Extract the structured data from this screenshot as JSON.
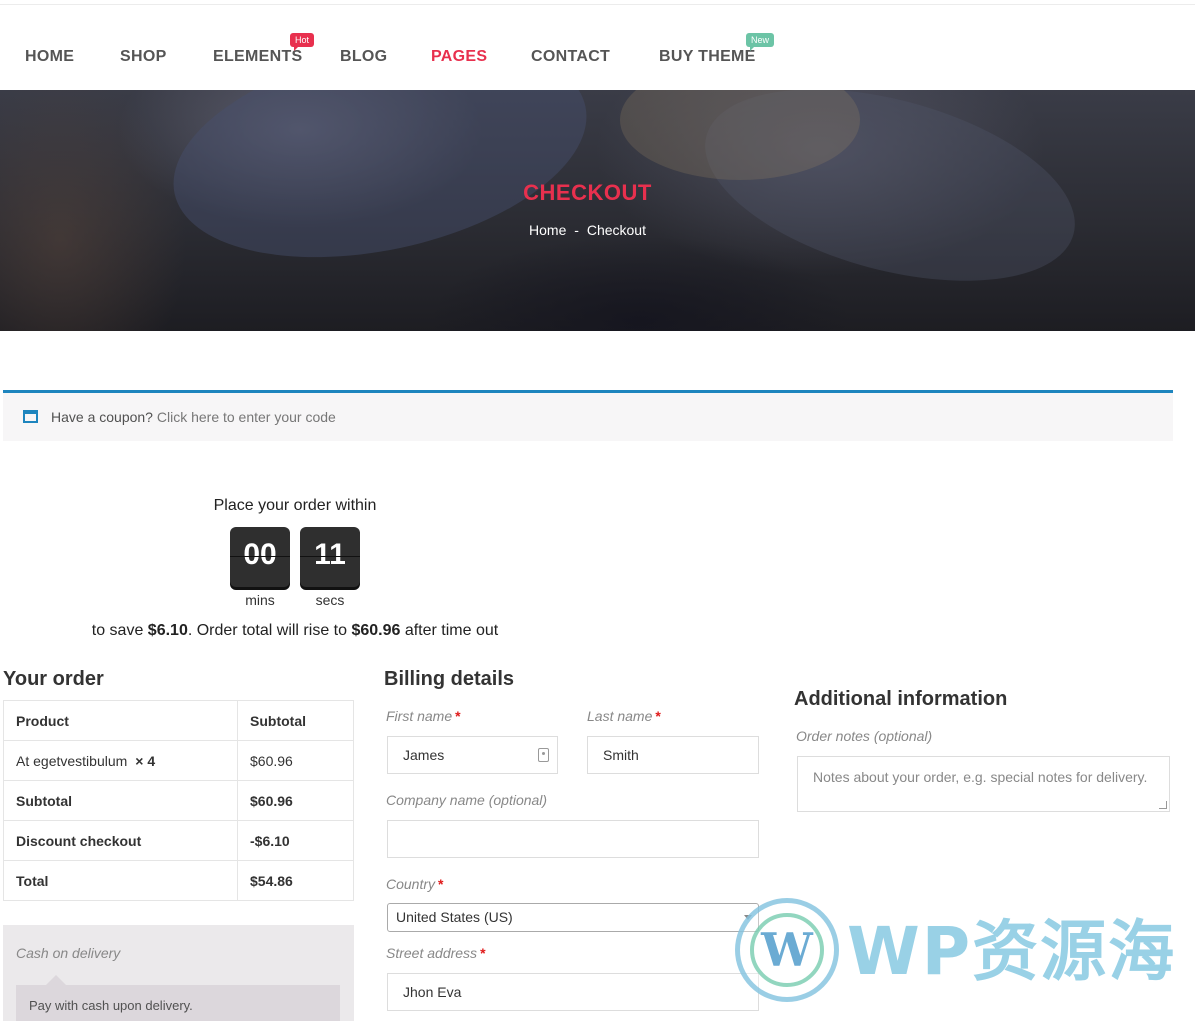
{
  "nav": {
    "items": [
      {
        "label": "HOME"
      },
      {
        "label": "SHOP"
      },
      {
        "label": "ELEMENTS",
        "badge": "Hot"
      },
      {
        "label": "BLOG"
      },
      {
        "label": "PAGES",
        "active": true
      },
      {
        "label": "CONTACT"
      },
      {
        "label": "BUY THEME",
        "badge": "New"
      }
    ],
    "active_color": "#e8304e",
    "hot_badge_color": "#e8304e",
    "new_badge_color": "#6cc4a6"
  },
  "hero": {
    "title": "CHECKOUT",
    "breadcrumb": {
      "home": "Home",
      "separator": "-",
      "current": "Checkout"
    }
  },
  "coupon": {
    "prompt": "Have a coupon?",
    "link": "Click here to enter your code",
    "accent_color": "#1e85be",
    "icon": "window-icon"
  },
  "countdown": {
    "title": "Place your order within",
    "mins": "00",
    "secs": "11",
    "mins_label": "mins",
    "secs_label": "secs",
    "save_prefix": "to save ",
    "save_amount": "$6.10",
    "save_middle": ". Order total will rise to ",
    "new_total": "$60.96",
    "save_suffix": " after time out"
  },
  "order": {
    "heading": "Your order",
    "header": {
      "product": "Product",
      "subtotal": "Subtotal"
    },
    "item": {
      "name": "At egetvestibulum",
      "qty": "× 4",
      "price": "$60.96"
    },
    "rows": [
      {
        "label": "Subtotal",
        "value": "$60.96"
      },
      {
        "label": "Discount checkout",
        "value": "-$6.10"
      },
      {
        "label": "Total",
        "value": "$54.86"
      }
    ]
  },
  "payment": {
    "method": "Cash on delivery",
    "description": "Pay with cash upon delivery."
  },
  "billing": {
    "heading": "Billing details",
    "first_name_label": "First name",
    "first_name_value": "James",
    "last_name_label": "Last name",
    "last_name_value": "Smith",
    "company_label": "Company name (optional)",
    "company_value": "",
    "country_label": "Country",
    "country_value": "United States (US)",
    "street_label": "Street address",
    "street_value": "Jhon Eva",
    "required_mark": "*"
  },
  "additional": {
    "heading": "Additional information",
    "notes_label": "Order notes (optional)",
    "notes_placeholder": "Notes about your order, e.g. special notes for delivery."
  },
  "watermark": {
    "logo_letter": "W",
    "text": "WP资源海"
  }
}
